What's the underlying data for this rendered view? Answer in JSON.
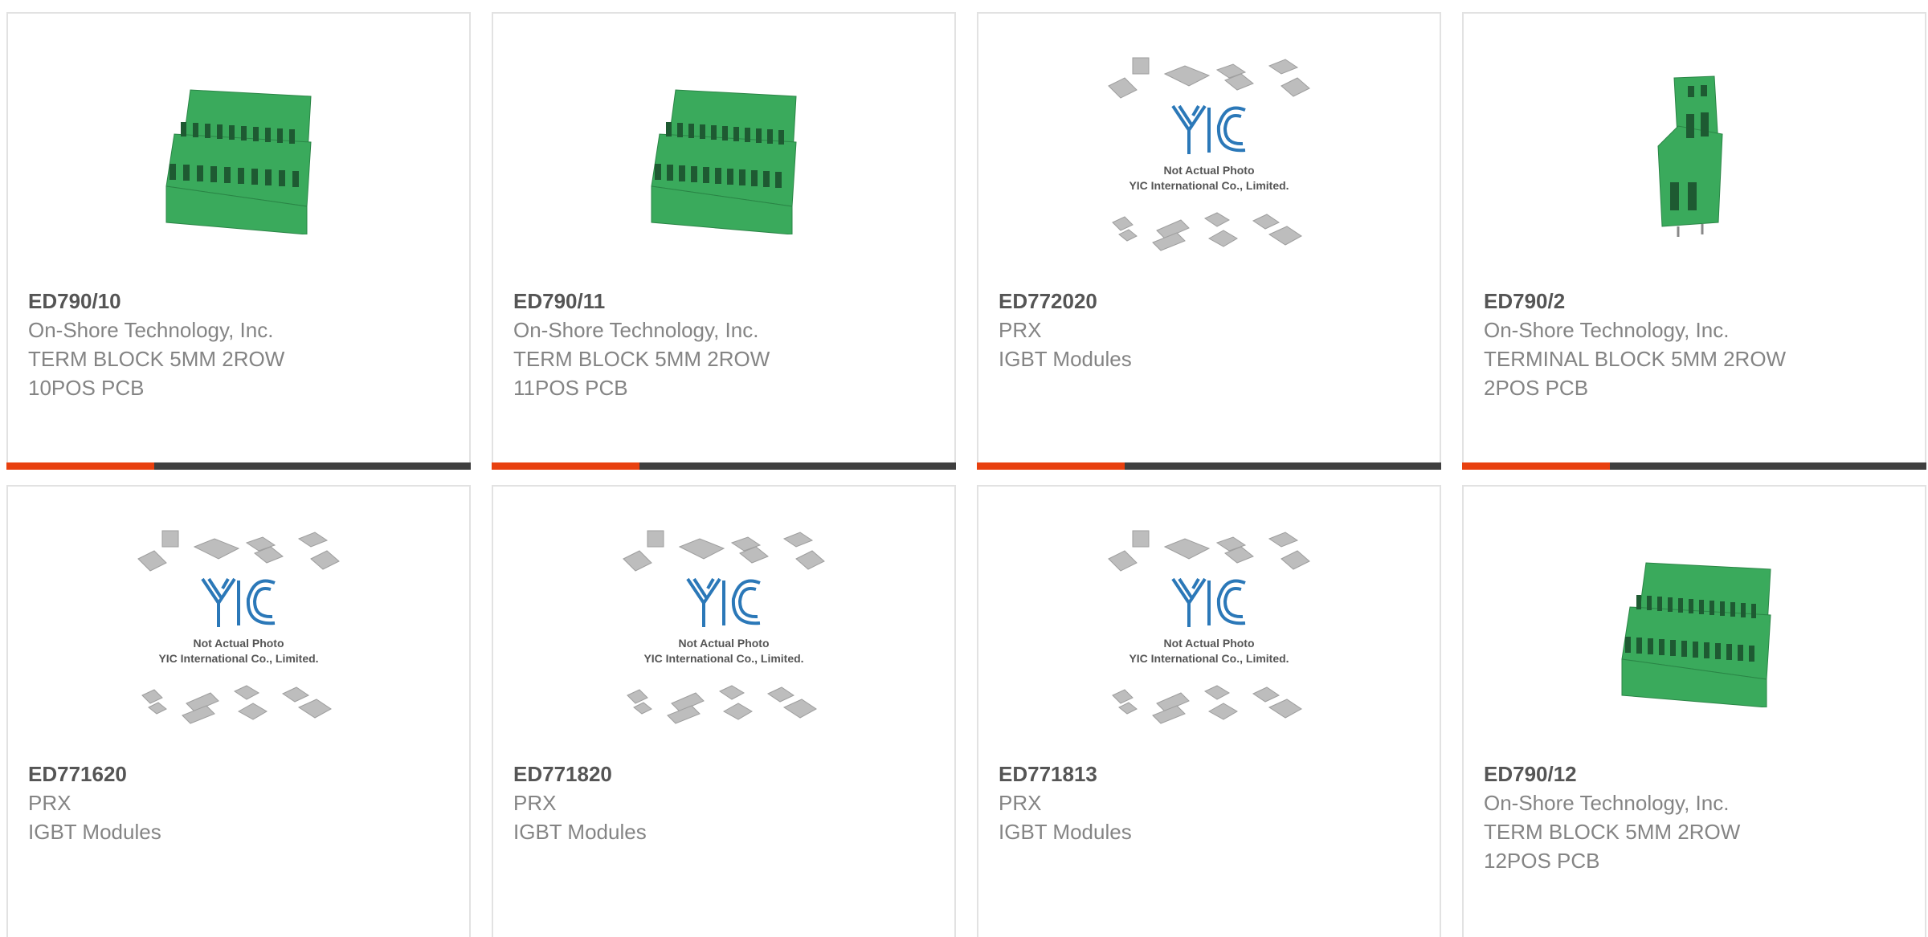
{
  "colors": {
    "accent": "#e8400f",
    "bar_dark": "#3f3f3f",
    "border": "#e2e2e2",
    "part_number": "#555555",
    "text": "#848484",
    "block_green": "#3aaa5c"
  },
  "products": [
    {
      "part_number": "ED790/10",
      "manufacturer": "On-Shore Technology, Inc.",
      "description_line1": "TERM BLOCK 5MM 2ROW",
      "description_line2": "10POS PCB",
      "image_icon": "terminal-block-icon"
    },
    {
      "part_number": "ED790/11",
      "manufacturer": "On-Shore Technology, Inc.",
      "description_line1": "TERM BLOCK 5MM 2ROW",
      "description_line2": "11POS PCB",
      "image_icon": "terminal-block-icon"
    },
    {
      "part_number": "ED772020",
      "manufacturer": "PRX",
      "description_line1": "IGBT Modules",
      "description_line2": "",
      "image_icon": "placeholder-chips-icon",
      "placeholder_line1": "Not Actual Photo",
      "placeholder_line2": "YIC International Co., Limited."
    },
    {
      "part_number": "ED790/2",
      "manufacturer": "On-Shore Technology, Inc.",
      "description_line1": "TERMINAL BLOCK 5MM 2ROW",
      "description_line2": "2POS PCB",
      "image_icon": "terminal-block-icon"
    },
    {
      "part_number": "ED771620",
      "manufacturer": "PRX",
      "description_line1": "IGBT Modules",
      "description_line2": "",
      "image_icon": "placeholder-chips-icon",
      "placeholder_line1": "Not Actual Photo",
      "placeholder_line2": "YIC International Co., Limited."
    },
    {
      "part_number": "ED771820",
      "manufacturer": "PRX",
      "description_line1": "IGBT Modules",
      "description_line2": "",
      "image_icon": "placeholder-chips-icon",
      "placeholder_line1": "Not Actual Photo",
      "placeholder_line2": "YIC International Co., Limited."
    },
    {
      "part_number": "ED771813",
      "manufacturer": "PRX",
      "description_line1": "IGBT Modules",
      "description_line2": "",
      "image_icon": "placeholder-chips-icon",
      "placeholder_line1": "Not Actual Photo",
      "placeholder_line2": "YIC International Co., Limited."
    },
    {
      "part_number": "ED790/12",
      "manufacturer": "On-Shore Technology, Inc.",
      "description_line1": "TERM BLOCK 5MM 2ROW",
      "description_line2": "12POS PCB",
      "image_icon": "terminal-block-icon"
    }
  ]
}
